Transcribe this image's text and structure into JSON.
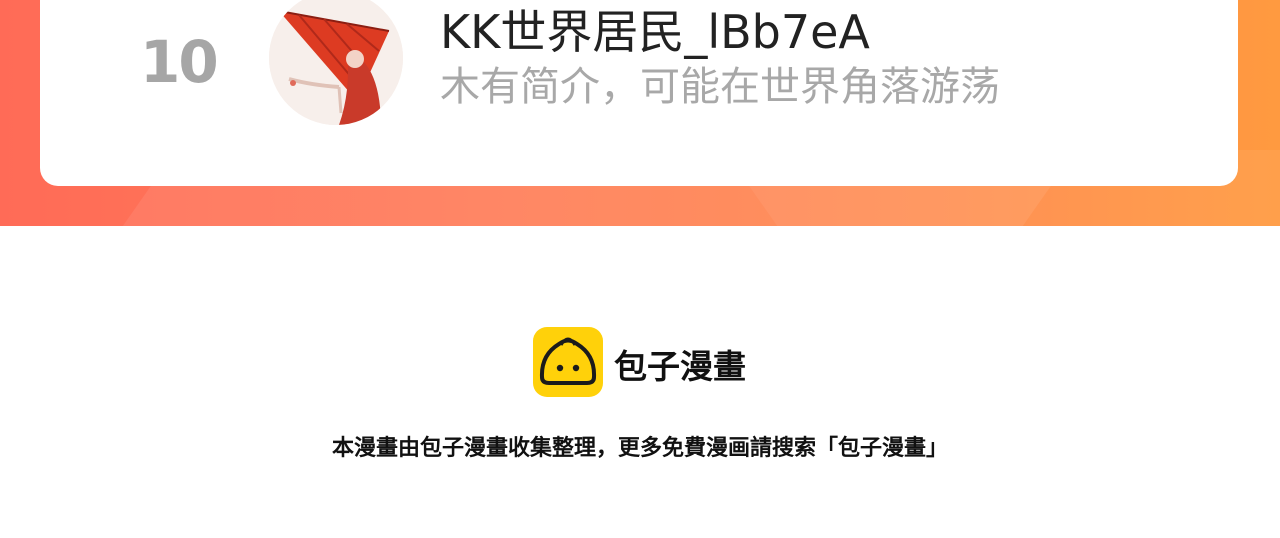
{
  "ranking_entry": {
    "rank": "10",
    "username": "KK世界居民_lBb7eA",
    "bio": "木有简介，可能在世界角落游荡",
    "avatar_icon": "user-avatar-red-umbrella"
  },
  "footer": {
    "logo_icon": "baozi-manhua-logo-icon",
    "brand": "包子漫畫",
    "note": "本漫畫由包子漫畫收集整理，更多免費漫画請搜索「包子漫畫」"
  },
  "colors": {
    "banner_start": "#ff6b57",
    "banner_end": "#ff9a40",
    "logo_yellow": "#ffd10a",
    "rank_gray": "#a6a6a6",
    "bio_gray": "#a8a8a8"
  }
}
